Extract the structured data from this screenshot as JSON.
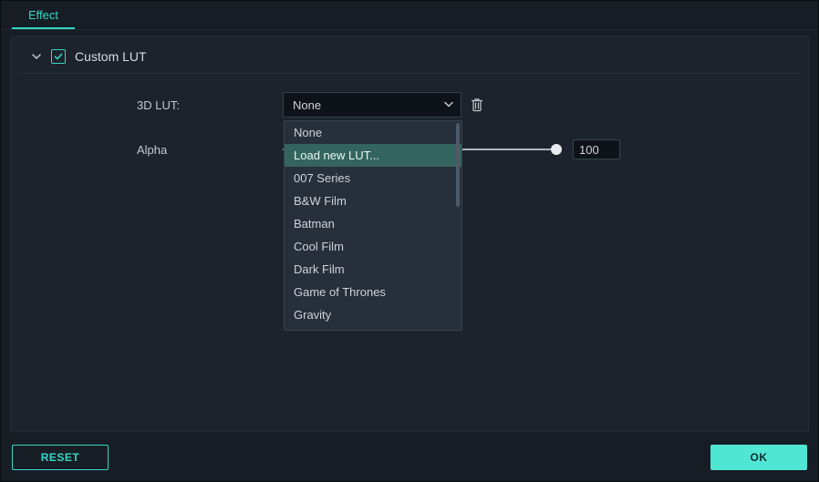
{
  "tabs": {
    "effect": "Effect"
  },
  "section": {
    "title": "Custom LUT",
    "checked": true
  },
  "labels": {
    "lut": "3D LUT:",
    "alpha": "Alpha"
  },
  "select": {
    "value": "None",
    "options": [
      {
        "label": "None"
      },
      {
        "label": "Load new LUT...",
        "hover": true
      },
      {
        "label": "007 Series"
      },
      {
        "label": "B&W Film"
      },
      {
        "label": "Batman"
      },
      {
        "label": "Cool Film"
      },
      {
        "label": "Dark Film"
      },
      {
        "label": "Game of Thrones"
      },
      {
        "label": "Gravity"
      }
    ]
  },
  "alpha": {
    "value": "100"
  },
  "footer": {
    "reset": "RESET",
    "ok": "OK"
  },
  "colors": {
    "accent": "#34d6c6",
    "panel": "#1c232c",
    "bg": "#171d25",
    "dropdownHover": "#34645e"
  }
}
